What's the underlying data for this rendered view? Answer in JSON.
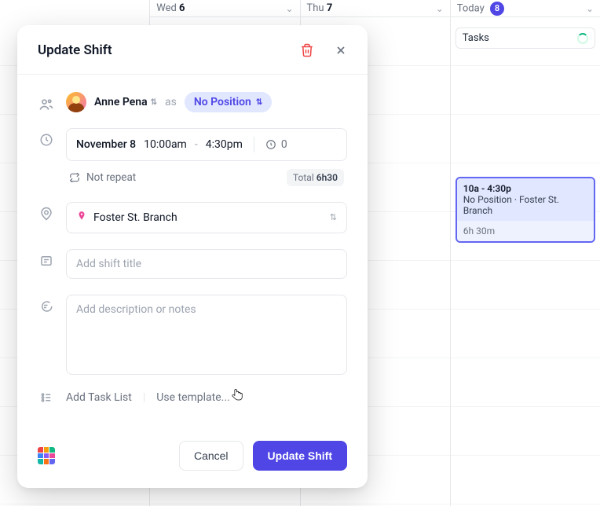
{
  "calendar": {
    "columns": [
      {
        "label_prefix": "",
        "label_strong": "",
        "show_header": false
      },
      {
        "label_prefix": "Wed ",
        "label_strong": "6"
      },
      {
        "label_prefix": "Thu ",
        "label_strong": "7"
      },
      {
        "label_prefix": "Today ",
        "label_strong": "",
        "today_count": "8"
      }
    ],
    "tasks_label": "Tasks",
    "shift_event": {
      "time": "10a - 4:30p",
      "meta": "No Position · Foster St. Branch",
      "duration": "6h 30m"
    }
  },
  "modal": {
    "title": "Update Shift",
    "assignee": {
      "name": "Anne Pena",
      "as_label": "as",
      "position": "No Position"
    },
    "time": {
      "date": "November 8",
      "start": "10:00am",
      "dash": "-",
      "end": "4:30pm",
      "break_value": "0"
    },
    "repeat": {
      "label": "Not repeat",
      "total_label": "Total",
      "total_value": "6h30"
    },
    "location": "Foster St. Branch",
    "title_placeholder": "Add shift title",
    "desc_placeholder": "Add description or notes",
    "tasks": {
      "add_label": "Add Task List",
      "template_label": "Use template..."
    },
    "buttons": {
      "cancel": "Cancel",
      "submit": "Update Shift"
    }
  }
}
